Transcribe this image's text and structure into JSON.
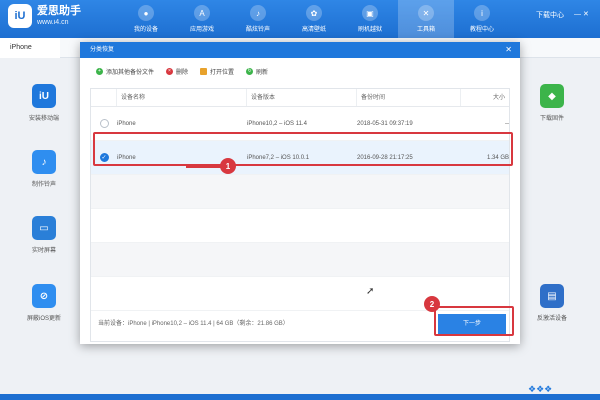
{
  "app": {
    "logo_badge": "iU",
    "logo_name": "爱思助手",
    "logo_url": "www.i4.cn",
    "download_center": "下载中心"
  },
  "nav": [
    {
      "label": "我的设备",
      "icon": "apple-icon"
    },
    {
      "label": "应用游戏",
      "icon": "app-store-icon"
    },
    {
      "label": "酷炫铃声",
      "icon": "bell-icon"
    },
    {
      "label": "高清壁纸",
      "icon": "wallpaper-icon"
    },
    {
      "label": "刷机越狱",
      "icon": "box-icon"
    },
    {
      "label": "工具箱",
      "icon": "tools-icon"
    },
    {
      "label": "教程中心",
      "icon": "info-icon"
    }
  ],
  "tab": {
    "label": "iPhone"
  },
  "tools_left": [
    {
      "label": "安装移动端",
      "color": "#1f78dc",
      "icon": "i4-app-icon"
    },
    {
      "label": "制作铃声",
      "color": "#2f8ef0",
      "icon": "bell-icon"
    },
    {
      "label": "实时屏幕",
      "color": "#2a7fd8",
      "icon": "screen-icon"
    },
    {
      "label": "屏蔽iOS更新",
      "color": "#2f8ef0",
      "icon": "block-update-icon"
    }
  ],
  "tools_right": [
    {
      "label": "下载固件",
      "color": "#3cb44a",
      "icon": "firmware-icon"
    },
    {
      "label": "反激活设备",
      "color": "#2f6fc8",
      "icon": "deactivate-icon"
    }
  ],
  "dialog": {
    "title": "分类恢复",
    "toolbar": [
      {
        "label": "添加其他备份文件",
        "color": "#3cb44a",
        "icon": "add-icon",
        "glyph": "+"
      },
      {
        "label": "删除",
        "color": "#d8383f",
        "icon": "delete-icon",
        "glyph": "×"
      },
      {
        "label": "打开位置",
        "color": "#e8a22c",
        "icon": "folder-icon",
        "glyph": ""
      },
      {
        "label": "刷新",
        "color": "#3cb44a",
        "icon": "refresh-icon",
        "glyph": "↻"
      }
    ],
    "columns": {
      "name": "设备名称",
      "version": "设备版本",
      "time": "备份时间",
      "size": "大小"
    },
    "rows": [
      {
        "name": "iPhone",
        "version": "iPhone10,2 – iOS 11.4",
        "time": "2018-05-31 09:37:19",
        "size": "--",
        "selected": false
      },
      {
        "name": "iPhone",
        "version": "iPhone7,2 – iOS 10.0.1",
        "time": "2016-09-28 21:17:25",
        "size": "1.34 GB",
        "selected": true
      }
    ],
    "footer": "当前设备：iPhone  |  iPhone10,2 – iOS 11.4  |  64 GB（剩余：21.86 GB）",
    "next_label": "下一步",
    "callouts": [
      "1",
      "2"
    ]
  },
  "colors": {
    "brand": "#1f78dc",
    "highlight": "#d8383f"
  }
}
